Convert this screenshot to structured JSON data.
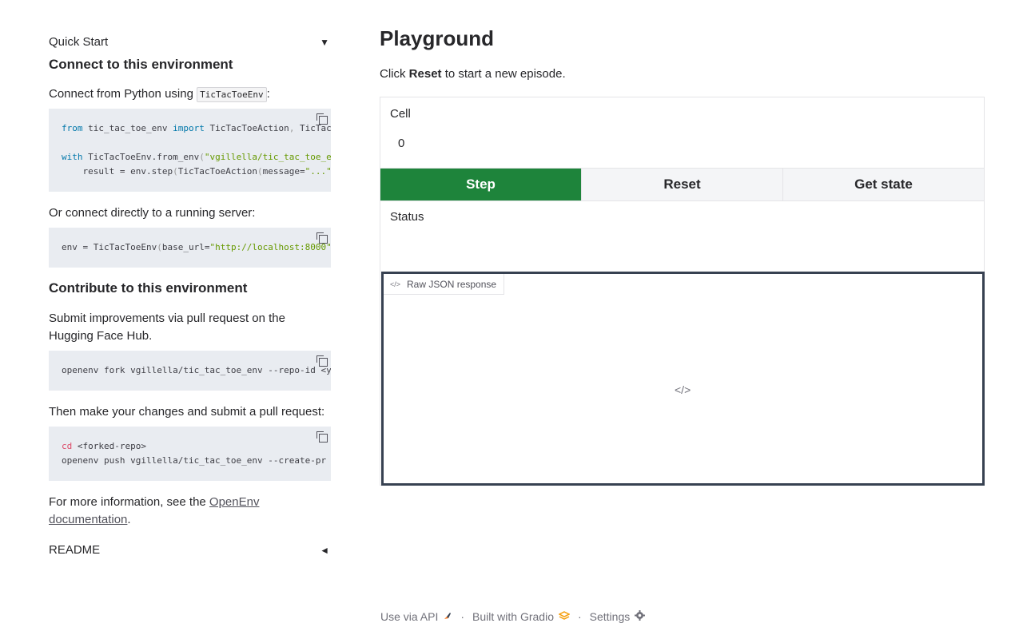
{
  "left": {
    "quick_start": "Quick Start",
    "quick_start_arrow": "▼",
    "connect_heading": "Connect to this environment",
    "connect_text_pre": "Connect from Python using ",
    "connect_code_inline": "TicTacToeEnv",
    "connect_text_post": ":",
    "code1": {
      "line1_kw1": "from",
      "line1_mod": " tic_tac_toe_env ",
      "line1_kw2": "import",
      "line1_rest": " TicTacToeAction",
      "line1_comma": ",",
      "line1_rest2": " TicTacToeEn",
      "line3_kw": "with",
      "line3_a": " TicTacToeEnv",
      "line3_b": ".from_env",
      "line3_p": "(",
      "line3_str": "\"vgillella/tic_tac_toe_env\"",
      "line3_end": ").",
      "line4_a": "    result = env.step",
      "line4_p1": "(",
      "line4_b": "TicTacToeAction",
      "line4_p2": "(",
      "line4_c": "message=",
      "line4_str": "\"...\"",
      "line4_end": "))"
    },
    "or_connect_text": "Or connect directly to a running server:",
    "code2": {
      "a": "env = TicTacToeEnv",
      "p": "(",
      "b": "base_url=",
      "str": "\"http://localhost:8000\"",
      "end": ")"
    },
    "contribute_heading": "Contribute to this environment",
    "contribute_text": "Submit improvements via pull request on the Hugging Face Hub.",
    "code3": "openenv fork vgillella/tic_tac_toe_env --repo-id <your-u",
    "then_text": "Then make your changes and submit a pull request:",
    "code4": {
      "cd": "cd",
      "line1_rest": " <forked-repo>",
      "line2": "openenv push vgillella/tic_tac_toe_env --create-pr"
    },
    "more_info_pre": "For more information, see the ",
    "more_info_link": "OpenEnv documentation",
    "more_info_post": ".",
    "readme": "README",
    "readme_arrow": "◄"
  },
  "right": {
    "title": "Playground",
    "hint_pre": "Click ",
    "hint_bold": "Reset",
    "hint_post": " to start a new episode.",
    "cell_label": "Cell",
    "cell_value": "0",
    "buttons": {
      "step": "Step",
      "reset": "Reset",
      "get_state": "Get state"
    },
    "status_label": "Status",
    "json_tab": "Raw JSON response",
    "json_tab_icon": "</>",
    "json_placeholder_icon": "</>"
  },
  "footer": {
    "api": "Use via API",
    "built": "Built with Gradio",
    "settings": "Settings",
    "dot": "·"
  },
  "colors": {
    "primary_button": "#1e843b",
    "code_bg": "#e9ecf1",
    "json_border": "#374151"
  }
}
